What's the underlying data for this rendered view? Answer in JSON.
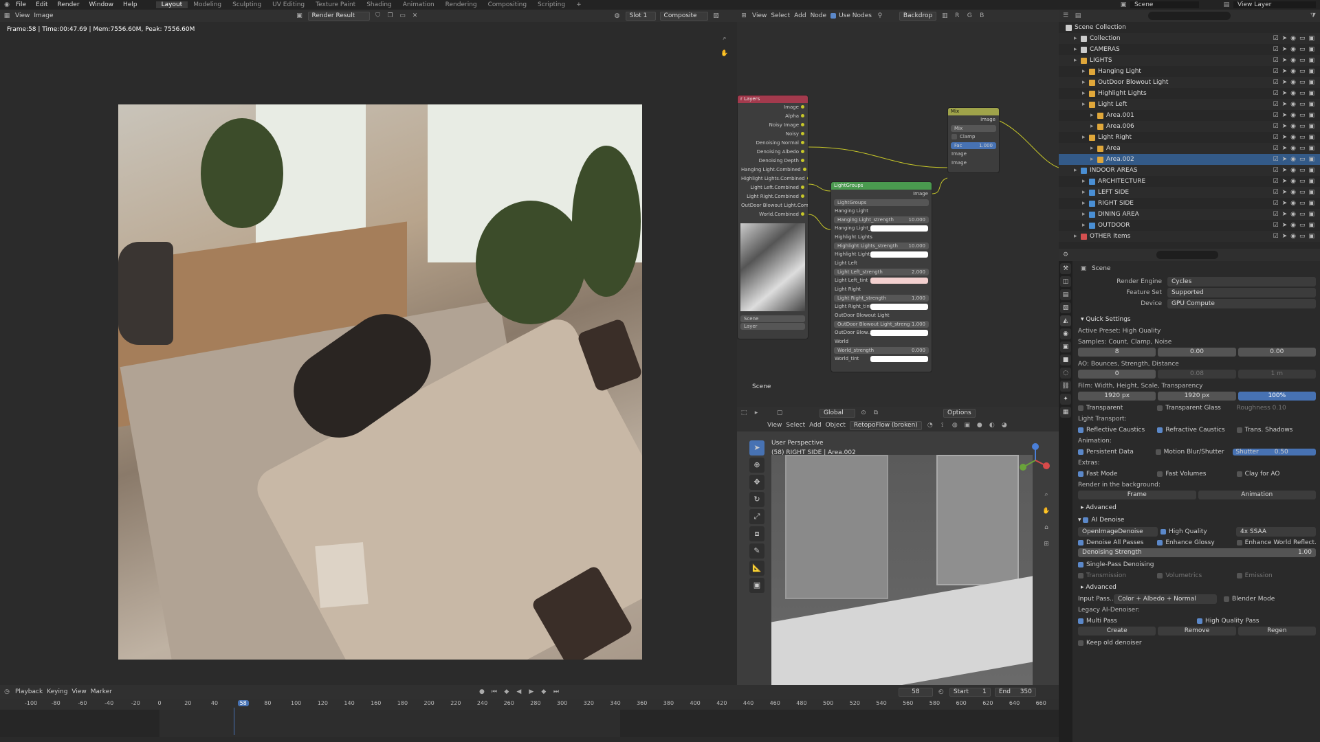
{
  "menus": [
    "File",
    "Edit",
    "Render",
    "Window",
    "Help"
  ],
  "workspaces": [
    "Layout",
    "Modeling",
    "Sculpting",
    "UV Editing",
    "Texture Paint",
    "Shading",
    "Animation",
    "Rendering",
    "Compositing",
    "Scripting"
  ],
  "active_workspace": "Layout",
  "scene_name": "Scene",
  "view_layer": "View Layer",
  "image_editor": {
    "view": "View",
    "image": "Image",
    "image_name": "Render Result",
    "slot": "Slot 1",
    "pass": "Composite",
    "stats": "Frame:58 | Time:00:47.69 | Mem:7556.60M, Peak: 7556.60M"
  },
  "node_editor": {
    "menus": [
      "View",
      "Select",
      "Add",
      "Node"
    ],
    "use_nodes": "Use Nodes",
    "backdrop": "Backdrop",
    "scene_label": "Scene",
    "render_layers": {
      "title": "r Layers",
      "outputs": [
        "Image",
        "Alpha",
        "Noisy Image",
        "Noisy",
        "Denoising Normal",
        "Denoising Albedo",
        "Denoising Depth",
        "Hanging Light.Combined",
        "Highlight Lights.Combined",
        "Light Left.Combined",
        "Light Right.Combined",
        "OutDoor Blowout Light.Combined",
        "World.Combined"
      ],
      "scene_field": "Scene",
      "layer_field": "Layer"
    },
    "mix": {
      "title": "Mix",
      "out": "Image",
      "blend": "Mix",
      "clamp": "Clamp",
      "fac_label": "Fac",
      "fac": "1.000",
      "in1": "Image",
      "in2": "Image"
    },
    "lightgroups": {
      "title": "LightGroups",
      "out": "Image",
      "group": "LightGroups",
      "items": [
        {
          "name": "Hanging Light",
          "field": "Hanging Light_strength",
          "value": "10.000",
          "tint": "Hanging Light_...",
          "tint_color": "#ffffff"
        },
        {
          "name": "Highlight Lights",
          "field": "Highlight Lights_strength",
          "value": "10.000",
          "tint": "Highlight Light...",
          "tint_color": "#ffffff"
        },
        {
          "name": "Light Left",
          "field": "Light Left_strength",
          "value": "2.000",
          "tint": "Light Left_tint",
          "tint_color": "#f3d0cf"
        },
        {
          "name": "Light Right",
          "field": "Light Right_strength",
          "value": "1.000",
          "tint": "Light Right_tint",
          "tint_color": "#ffffff"
        },
        {
          "name": "OutDoor Blowout Light",
          "field": "OutDoor Blowout Light_streng",
          "value": "1.000",
          "tint": "OutDoor Blow...",
          "tint_color": "#ffffff"
        },
        {
          "name": "World",
          "field": "World_strength",
          "value": "0.000",
          "tint": "World_tint",
          "tint_color": "#ffffff"
        }
      ]
    }
  },
  "viewport": {
    "menus": [
      "View",
      "Select",
      "Add",
      "Object"
    ],
    "addon": "RetopoFlow (broken)",
    "transform": "Global",
    "options": "Options",
    "perspective": "User Perspective",
    "context": "(58) RIGHT SIDE | Area.002"
  },
  "outliner": {
    "root": "Scene Collection",
    "items": [
      {
        "label": "Collection",
        "depth": 1,
        "color": "#cccccc",
        "sel": false
      },
      {
        "label": "CAMERAS",
        "depth": 1,
        "color": "#cccccc",
        "sel": false
      },
      {
        "label": "LIGHTS",
        "depth": 1,
        "color": "#e0a73a",
        "sel": false
      },
      {
        "label": "Hanging Light",
        "depth": 2,
        "color": "#e0a73a",
        "sel": false
      },
      {
        "label": "OutDoor Blowout Light",
        "depth": 2,
        "color": "#e0a73a",
        "sel": false
      },
      {
        "label": "Highlight Lights",
        "depth": 2,
        "color": "#e0a73a",
        "sel": false
      },
      {
        "label": "Light Left",
        "depth": 2,
        "color": "#e0a73a",
        "sel": false
      },
      {
        "label": "Area.001",
        "depth": 3,
        "color": "#e0a73a",
        "sel": false
      },
      {
        "label": "Area.006",
        "depth": 3,
        "color": "#e0a73a",
        "sel": false
      },
      {
        "label": "Light Right",
        "depth": 2,
        "color": "#e0a73a",
        "sel": false
      },
      {
        "label": "Area",
        "depth": 3,
        "color": "#e0a73a",
        "sel": false
      },
      {
        "label": "Area.002",
        "depth": 3,
        "color": "#e0a73a",
        "sel": true
      },
      {
        "label": "INDOOR AREAS",
        "depth": 1,
        "color": "#4a8fd4",
        "sel": false
      },
      {
        "label": "ARCHITECTURE",
        "depth": 2,
        "color": "#4a8fd4",
        "sel": false
      },
      {
        "label": "LEFT SIDE",
        "depth": 2,
        "color": "#4a8fd4",
        "sel": false
      },
      {
        "label": "RIGHT SIDE",
        "depth": 2,
        "color": "#4a8fd4",
        "sel": false
      },
      {
        "label": "DINING AREA",
        "depth": 2,
        "color": "#4a8fd4",
        "sel": false
      },
      {
        "label": "OUTDOOR",
        "depth": 2,
        "color": "#4a8fd4",
        "sel": false
      },
      {
        "label": "OTHER Items",
        "depth": 1,
        "color": "#d45050",
        "sel": false
      }
    ]
  },
  "properties": {
    "scene": "Scene",
    "render_engine_label": "Render Engine",
    "render_engine": "Cycles",
    "feature_set_label": "Feature Set",
    "feature_set": "Supported",
    "device_label": "Device",
    "device": "GPU Compute",
    "quick_settings": "Quick Settings",
    "active_preset": "Active Preset: High Quality",
    "samples_label": "Samples: Count, Clamp, Noise",
    "samples": [
      "8",
      "0.00",
      "0.00"
    ],
    "ao_label": "AO: Bounces, Strength, Distance",
    "ao": [
      "0",
      "0.08",
      "1 m"
    ],
    "film_label": "Film: Width, Height, Scale, Transparency",
    "film": [
      "1920 px",
      "1920 px",
      "100%"
    ],
    "transp": [
      "Transparent",
      "Transparent Glass",
      "Roughness",
      "0.10"
    ],
    "light_transport": "Light Transport:",
    "lt_checks": [
      "Reflective Caustics",
      "Refractive Caustics",
      "Trans. Shadows"
    ],
    "animation": "Animation:",
    "anim_checks": [
      "Persistent Data",
      "Motion Blur/Shutter"
    ],
    "shutter_label": "Shutter",
    "shutter": "0.50",
    "extras": "Extras:",
    "extra_checks": [
      "Fast Mode",
      "Fast Volumes",
      "Clay for AO"
    ],
    "background": "Render in the background:",
    "bg_buttons": [
      "Frame",
      "Animation"
    ],
    "advanced": "Advanced",
    "ai_denoise": "AI Denoise",
    "denoiser": "OpenImageDenoise",
    "high_quality": "High Quality",
    "ssaa": "4x SSAA",
    "denoise_checks": [
      "Denoise All Passes",
      "Enhance Glossy",
      "Enhance World Reflect..."
    ],
    "strength_label": "Denoising Strength",
    "strength": "1.00",
    "single_pass": "Single-Pass Denoising",
    "pass_checks": [
      "Transmission",
      "Volumetrics",
      "Emission"
    ],
    "advanced2": "Advanced",
    "input_pass_label": "Input Pass...",
    "input_pass": "Color + Albedo + Normal",
    "blender_mode": "Blender Mode",
    "legacy": "Legacy AI-Denoiser:",
    "multi_pass": "Multi Pass",
    "hq_pass": "High Quality Pass",
    "action_buttons": [
      "Create",
      "Remove",
      "Regen"
    ],
    "keep_old": "Keep old denoiser"
  },
  "timeline": {
    "menus": [
      "Playback",
      "Keying",
      "View",
      "Marker"
    ],
    "current_frame": "58",
    "start_label": "Start",
    "start": "1",
    "end_label": "End",
    "end": "350",
    "ticks": [
      "-100",
      "-80",
      "-60",
      "-40",
      "-20",
      "0",
      "20",
      "40",
      "58",
      "80",
      "100",
      "120",
      "140",
      "160",
      "180",
      "200",
      "220",
      "240",
      "260",
      "280",
      "300",
      "320",
      "340",
      "360",
      "380",
      "400",
      "420",
      "440",
      "460",
      "480",
      "500",
      "520",
      "540",
      "560",
      "580",
      "600",
      "620",
      "640",
      "660"
    ]
  },
  "colors": {
    "accent": "#4772b3",
    "header": "#303030",
    "panel": "#2a2a2a"
  }
}
